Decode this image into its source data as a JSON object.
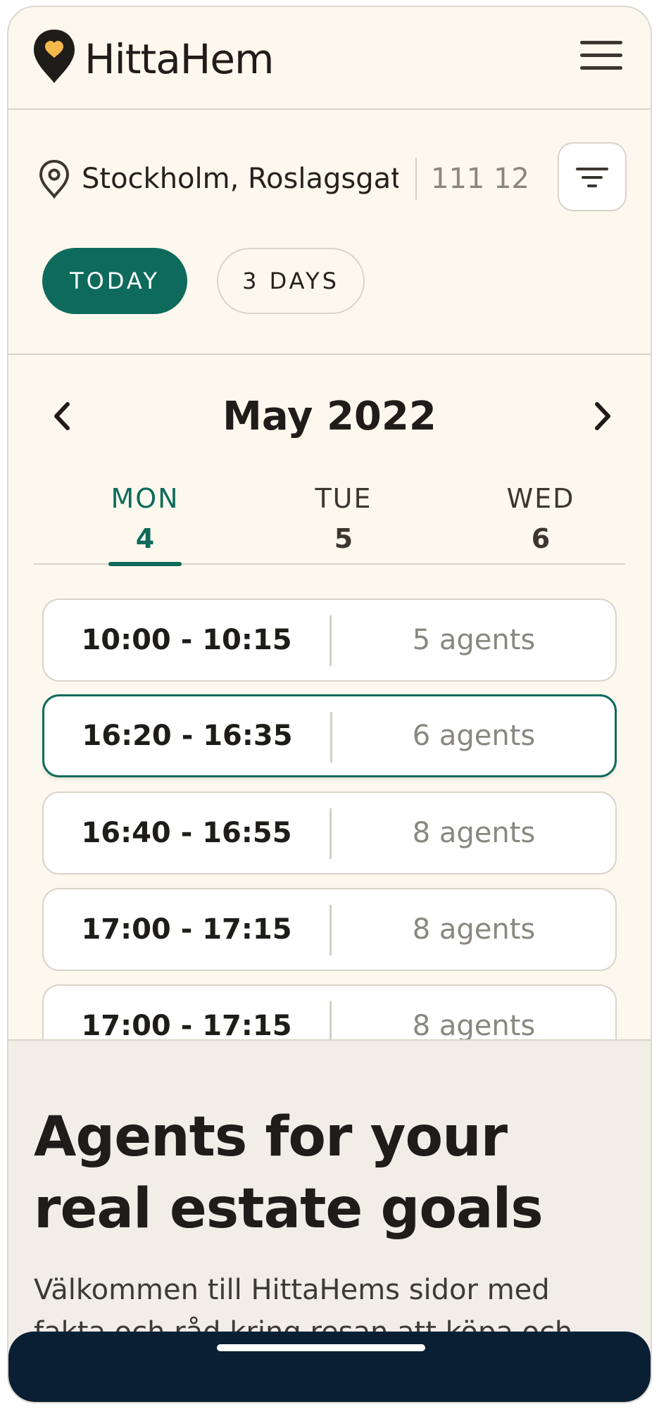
{
  "header": {
    "brand": "HittaHem",
    "logo_icon": "map-pin-heart-icon",
    "menu_icon": "hamburger-menu-icon"
  },
  "location": {
    "address": "Stockholm, Roslagsgat..",
    "postcode": "111 12",
    "pin_icon": "map-pin-icon",
    "filter_icon": "filter-icon"
  },
  "range": {
    "today": "TODAY",
    "three_days": "3 DAYS",
    "selected": "TODAY"
  },
  "calendar": {
    "month": "May 2022",
    "days": [
      {
        "name": "MON",
        "date": "4",
        "active": true
      },
      {
        "name": "TUE",
        "date": "5",
        "active": false
      },
      {
        "name": "WED",
        "date": "6",
        "active": false
      }
    ]
  },
  "slots": [
    {
      "time": "10:00 - 10:15",
      "agents": "5 agents",
      "selected": false
    },
    {
      "time": "16:20 - 16:35",
      "agents": "6 agents",
      "selected": true
    },
    {
      "time": "16:40 - 16:55",
      "agents": "8 agents",
      "selected": false
    },
    {
      "time": "17:00 - 17:15",
      "agents": "8 agents",
      "selected": false
    },
    {
      "time": "17:00 - 17:15",
      "agents": "8 agents",
      "selected": false
    }
  ],
  "info": {
    "heading": "Agents for your real estate goals",
    "body": "Välkommen till HittaHems sidor med fakta och råd kring resan att köpa och sälja en"
  },
  "colors": {
    "accent": "#0e6b5c",
    "background": "#fdf8ee",
    "info_background": "#f1eee8",
    "bottom_bar": "#0a1f33"
  }
}
